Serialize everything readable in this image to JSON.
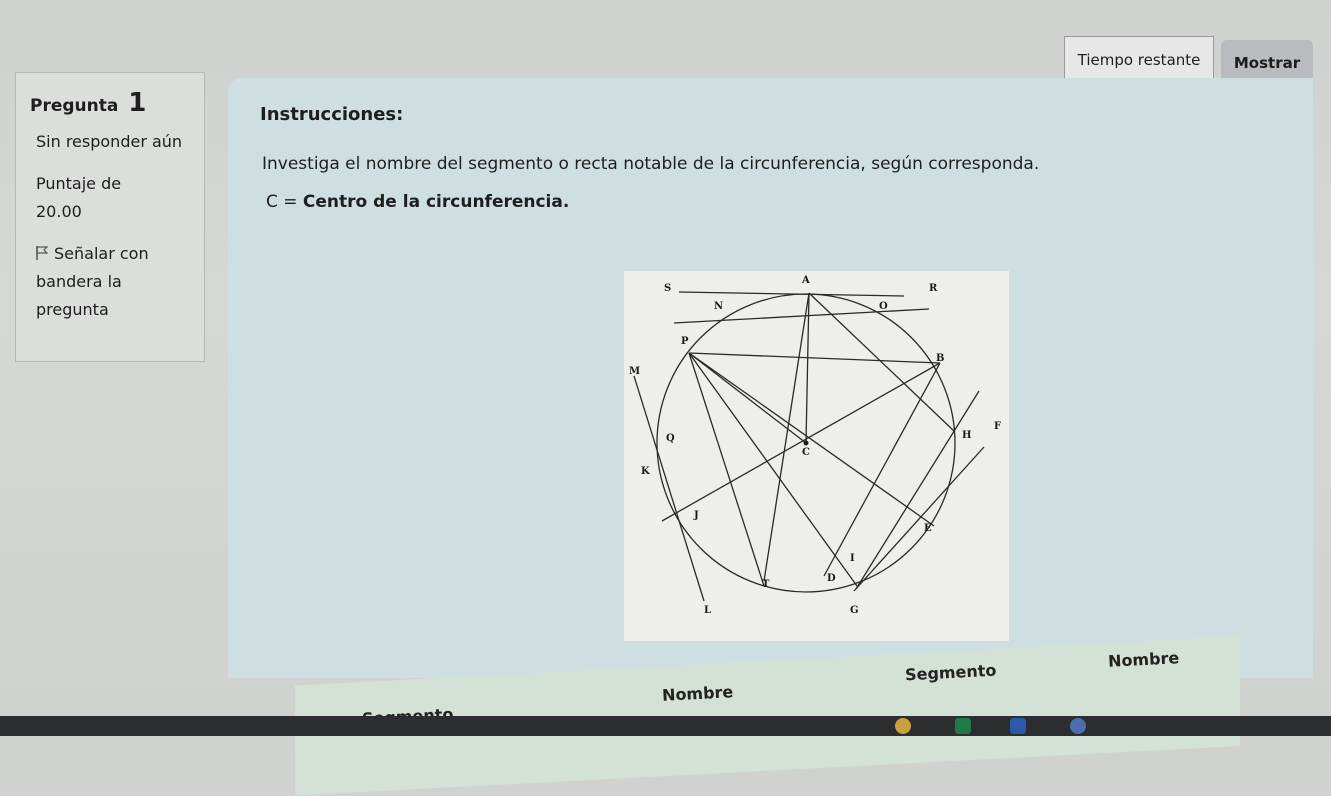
{
  "timer": {
    "label": "Tiempo restante",
    "button": "Mostrar"
  },
  "question": {
    "title": "Pregunta",
    "number": "1",
    "status": "Sin responder aún",
    "score_label": "Puntaje de",
    "score_value": "20.00",
    "flag_label": "Señalar con bandera la pregunta"
  },
  "content": {
    "heading": "Instrucciones:",
    "instruction": "Investiga el nombre del segmento o recta notable de la circunferencia, según corresponda.",
    "center_prefix": "C = ",
    "center_text": "Centro de la circunferencia."
  },
  "figure_labels": [
    "S",
    "A",
    "R",
    "N",
    "O",
    "P",
    "B",
    "M",
    "Q",
    "C",
    "H",
    "F",
    "K",
    "J",
    "E",
    "I",
    "T",
    "D",
    "L",
    "G"
  ],
  "table": {
    "headers": [
      "Segmento",
      "Nombre",
      "Segmento",
      "Nombre"
    ]
  },
  "taskbar_icons": [
    "chrome-icon",
    "excel-icon",
    "word-icon",
    "app-icon"
  ]
}
